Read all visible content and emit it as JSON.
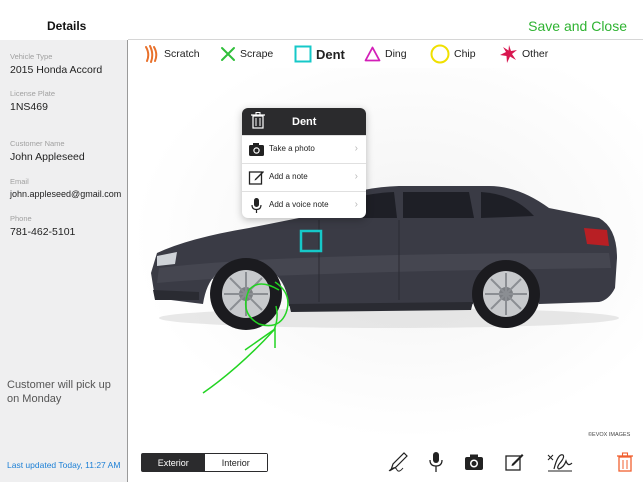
{
  "header": {
    "title": "Details",
    "save_label": "Save and Close"
  },
  "sidebar": {
    "fields": [
      {
        "label": "Vehicle Type",
        "value": "2015 Honda Accord"
      },
      {
        "label": "License Plate",
        "value": "1NS469"
      },
      {
        "label": "Customer Name",
        "value": "John Appleseed"
      },
      {
        "label": "Email",
        "value": "john.appleseed@gmail.com"
      },
      {
        "label": "Phone",
        "value": "781-462-5101"
      }
    ],
    "note": "Customer will pick up on Monday",
    "last_updated": "Last updated Today, 11:27 AM"
  },
  "damage_types": [
    {
      "label": "Scratch",
      "icon": "scratch-icon",
      "color": "#e8702a"
    },
    {
      "label": "Scrape",
      "icon": "scrape-x-icon",
      "color": "#2fbf3a"
    },
    {
      "label": "Dent",
      "icon": "dent-square-icon",
      "color": "#16c8c8",
      "selected": true
    },
    {
      "label": "Ding",
      "icon": "ding-triangle-icon",
      "color": "#d31fb8"
    },
    {
      "label": "Chip",
      "icon": "chip-circle-icon",
      "color": "#f0e000"
    },
    {
      "label": "Other",
      "icon": "other-star-icon",
      "color": "#d8164f"
    }
  ],
  "popover": {
    "title": "Dent",
    "items": [
      {
        "label": "Take a photo",
        "icon": "camera-icon"
      },
      {
        "label": "Add a note",
        "icon": "note-icon"
      },
      {
        "label": "Add a voice note",
        "icon": "microphone-icon"
      }
    ]
  },
  "canvas": {
    "credit": "©EVOX IMAGES",
    "car_color": "#3a3b45",
    "sketch_color": "#22d422"
  },
  "view_toggle": {
    "options": [
      "Exterior",
      "Interior"
    ],
    "selected": "Exterior"
  },
  "bottom_tools": [
    "pen-icon",
    "microphone-icon",
    "camera-icon",
    "note-icon",
    "signature-icon",
    "trash-icon"
  ]
}
